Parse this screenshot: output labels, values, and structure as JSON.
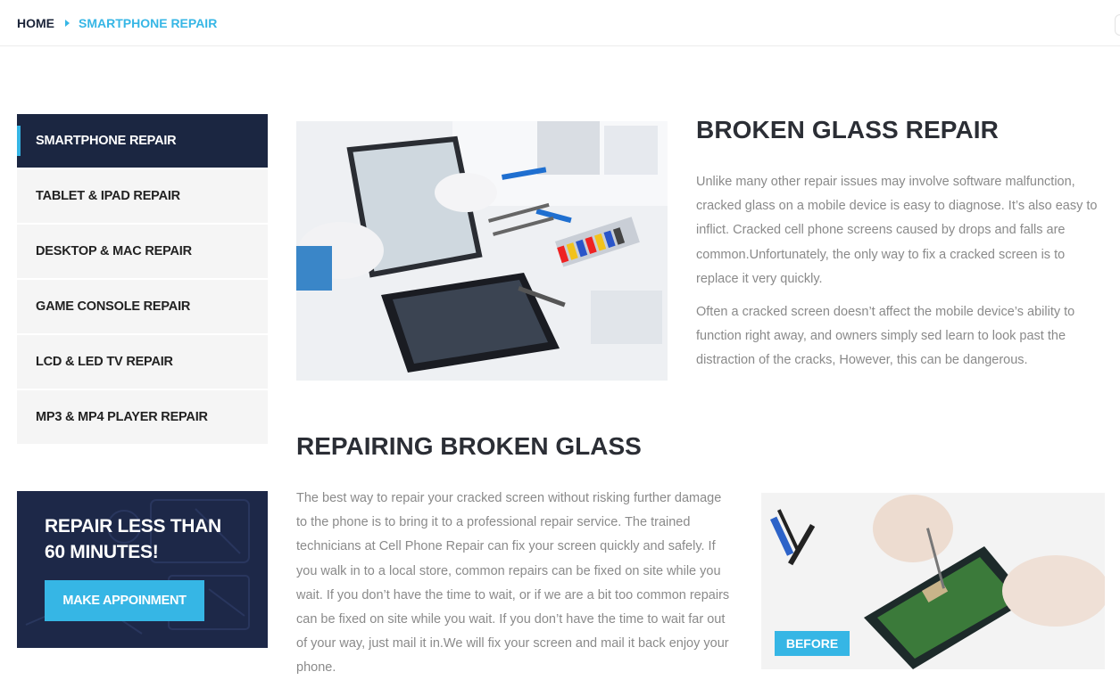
{
  "breadcrumb": {
    "home": "HOME",
    "current": "SMARTPHONE REPAIR"
  },
  "sidebar": {
    "items": [
      {
        "label": "SMARTPHONE REPAIR",
        "active": true
      },
      {
        "label": "TABLET & IPAD REPAIR",
        "active": false
      },
      {
        "label": "DESKTOP & MAC REPAIR",
        "active": false
      },
      {
        "label": "GAME CONSOLE REPAIR",
        "active": false
      },
      {
        "label": "LCD & LED TV REPAIR",
        "active": false
      },
      {
        "label": "MP3 & MP4 PLAYER REPAIR",
        "active": false
      }
    ]
  },
  "promo": {
    "title_line1": "REPAIR LESS THAN",
    "title_line2": "60 MINUTES!",
    "button": "MAKE APPOINMENT"
  },
  "section1": {
    "heading": "BROKEN GLASS REPAIR",
    "para1": "Unlike many other repair issues may involve software malfunction, cracked glass on a mobile device is easy to diagnose. It’s also easy to inflict. Cracked cell phone screens caused by drops and falls are common.Unfortunately, the only way to fix a cracked screen is to replace it very quickly.",
    "para2": "Often a cracked screen doesn’t affect the mobile device’s ability to function right away, and owners simply sed learn to look past the distraction of the cracks, However, this can be dangerous."
  },
  "section2": {
    "heading": "REPAIRING BROKEN GLASS",
    "para": "The best way to repair your cracked screen without risking further damage to the phone is to bring it to a professional repair service. The trained technicians at Cell Phone Repair can fix your screen quickly and safely. If you walk in to a local store, common repairs can be fixed on site while you wait. If you don’t have the time to wait, or if we are a bit too common repairs can be fixed on site while you wait. If you don’t have the time to wait far out of your way, just mail it in.We will fix your screen and mail it back enjoy your phone.",
    "badge": "BEFORE"
  },
  "colors": {
    "accent": "#36b6e5",
    "navy": "#1b2641",
    "heading": "#2b2e35",
    "body_text": "#8a8a8a"
  }
}
